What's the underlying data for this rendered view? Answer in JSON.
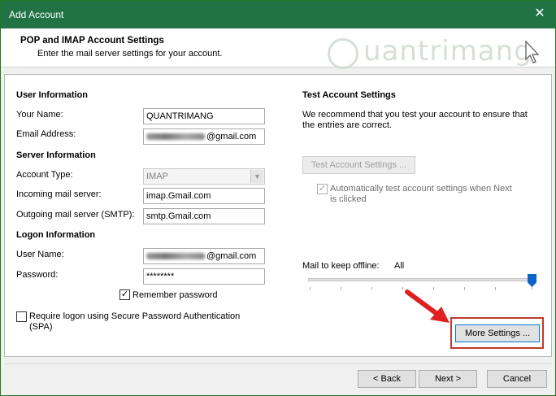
{
  "window": {
    "title": "Add Account",
    "close_glyph": "✕"
  },
  "header": {
    "title": "POP and IMAP Account Settings",
    "subtitle": "Enter the mail server settings for your account."
  },
  "watermark": {
    "text": "uantrimang"
  },
  "user_info": {
    "section": "User Information",
    "your_name_label": "Your Name:",
    "your_name_value": "QUANTRIMANG",
    "email_label": "Email Address:",
    "email_value": "@gmail.com"
  },
  "server_info": {
    "section": "Server Information",
    "account_type_label": "Account Type:",
    "account_type_value": "IMAP",
    "incoming_label": "Incoming mail server:",
    "incoming_value": "imap.Gmail.com",
    "outgoing_label": "Outgoing mail server (SMTP):",
    "outgoing_value": "smtp.Gmail.com"
  },
  "logon_info": {
    "section": "Logon Information",
    "user_name_label": "User Name:",
    "user_name_value": "@gmail.com",
    "password_label": "Password:",
    "password_value": "********",
    "remember_label": "Remember password",
    "remember_checked": true,
    "spa_label_line1": "Require logon using Secure Password Authentication",
    "spa_label_line2": "(SPA)",
    "spa_checked": false
  },
  "test": {
    "section": "Test Account Settings",
    "description_line1": "We recommend that you test your account to ensure that",
    "description_line2": "the entries are correct.",
    "test_button": "Test Account Settings ...",
    "auto_test_line1": "Automatically test account settings when Next",
    "auto_test_line2": "is clicked",
    "auto_test_checked": true
  },
  "offline": {
    "label": "Mail to keep offline:",
    "value": "All",
    "slider_fraction": 1.0
  },
  "buttons": {
    "more_settings": "More Settings ...",
    "back": "< Back",
    "next": "Next >",
    "cancel": "Cancel"
  },
  "colors": {
    "titlebar": "#217346",
    "highlight_box": "#c0392b",
    "slider_thumb": "#0a64c8"
  },
  "icons": [
    "close-icon",
    "cursor-icon",
    "red-arrow-icon",
    "checkmark-icon",
    "chevron-down-icon"
  ]
}
